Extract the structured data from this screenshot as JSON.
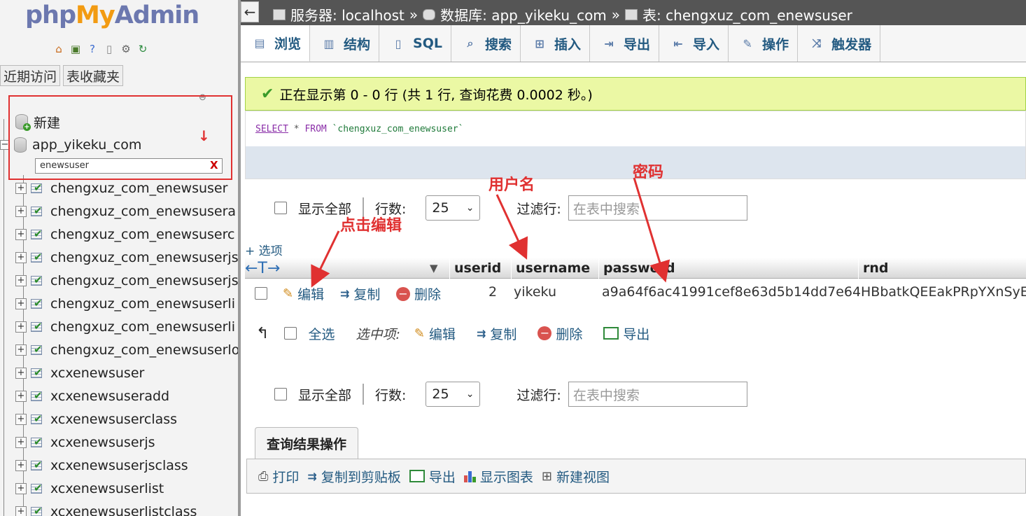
{
  "left": {
    "logo": {
      "php": "php",
      "my": "My",
      "admin": "Admin"
    },
    "quick_icons": [
      "home-icon",
      "exit-icon",
      "help-icon",
      "docs-icon",
      "settings-icon",
      "reload-icon"
    ],
    "recent_label": "近期访问",
    "favorites_label": "表收藏夹",
    "new_label": "新建",
    "db_name": "app_yikeku_com",
    "filter_value": "enewsuser",
    "filter_clear": "X",
    "tables": [
      "chengxuz_com_enewsuser",
      "chengxuz_com_enewsusera",
      "chengxuz_com_enewsuserc",
      "chengxuz_com_enewsuserjs",
      "chengxuz_com_enewsuserjs",
      "chengxuz_com_enewsuserli",
      "chengxuz_com_enewsuserli",
      "chengxuz_com_enewsuserlo",
      "xcxenewsuser",
      "xcxenewsuseradd",
      "xcxenewsuserclass",
      "xcxenewsuserjs",
      "xcxenewsuserjsclass",
      "xcxenewsuserlist",
      "xcxenewsuserlistclass"
    ]
  },
  "breadcrumb": {
    "server_label": "服务器: localhost",
    "db_label": "数据库: app_yikeku_com",
    "table_label": "表: chengxuz_com_enewsuser",
    "sep": "»"
  },
  "tabs": [
    "浏览",
    "结构",
    "SQL",
    "搜索",
    "插入",
    "导出",
    "导入",
    "操作",
    "触发器"
  ],
  "success_message": "正在显示第 0 - 0 行 (共 1 行, 查询花费 0.0002 秒。)",
  "sql": {
    "select": "SELECT",
    "star": "*",
    "from": "FROM",
    "table": "`chengxuz_com_enewsuser`"
  },
  "nav": {
    "show_all": "显示全部",
    "rows_label": "行数:",
    "rows_value": "25",
    "filter_label": "过滤行:",
    "filter_placeholder": "在表中搜索"
  },
  "options_link": "+ 选项",
  "columns": [
    "userid",
    "username",
    "password",
    "rnd"
  ],
  "row": {
    "edit": "编辑",
    "copy": "复制",
    "delete": "删除",
    "userid": "2",
    "username": "yikeku",
    "password": "a9a64f6ac41991cef8e63d5b14dd7e64",
    "rnd": "HBbatkQEEakPRpYXnSyE"
  },
  "bulk": {
    "select_all": "全选",
    "with_selected": "选中项:",
    "edit": "编辑",
    "copy": "复制",
    "delete": "删除",
    "export": "导出"
  },
  "query_ops": {
    "title": "查询结果操作",
    "print": "打印",
    "copy_clipboard": "复制到剪贴板",
    "export": "导出",
    "show_chart": "显示图表",
    "create_view": "新建视图"
  },
  "annotations": {
    "click_edit": "点击编辑",
    "username": "用户名",
    "password": "密码"
  },
  "colors": {
    "annotation": "#e03131",
    "link": "#235a81",
    "success_bg": "#ebf8a4",
    "topbar": "#555555"
  }
}
